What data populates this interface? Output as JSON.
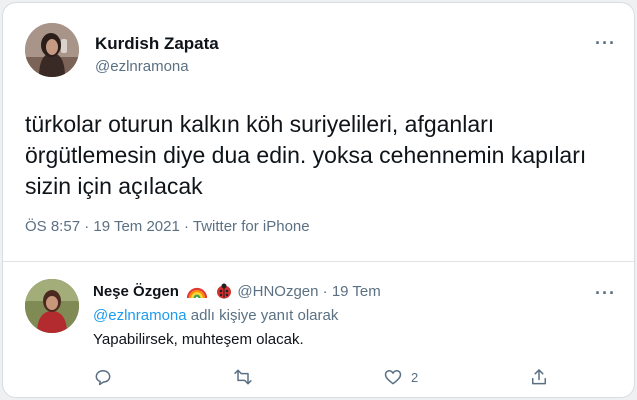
{
  "tweet": {
    "author_name": "Kurdish Zapata",
    "author_handle": "@ezlnramona",
    "text": "türkolar oturun kalkın köh suriyelileri, afganları örgütlemesin diye dua edin. yoksa cehennemin kapıları sizin için açılacak",
    "meta": "ÖS 8:57 · 19 Tem 2021 · Twitter for iPhone",
    "more_label": "···"
  },
  "reply": {
    "author_name": "Neşe Özgen",
    "author_handle": "@HNOzgen",
    "separator": "·",
    "date": "19 Tem",
    "reply_to_mention": "@ezlnramona",
    "reply_to_suffix": " adlı kişiye yanıt olarak",
    "text": "Yapabilirsek, muhteşem olacak.",
    "more_label": "···",
    "actions": {
      "reply_icon": "comment-icon",
      "retweet_icon": "retweet-icon",
      "like_icon": "heart-icon",
      "like_count": "2",
      "share_icon": "share-icon"
    }
  },
  "colors": {
    "accent": "#1d9bf0",
    "secondary_text": "#5b7083",
    "primary_text": "#0f1419"
  }
}
